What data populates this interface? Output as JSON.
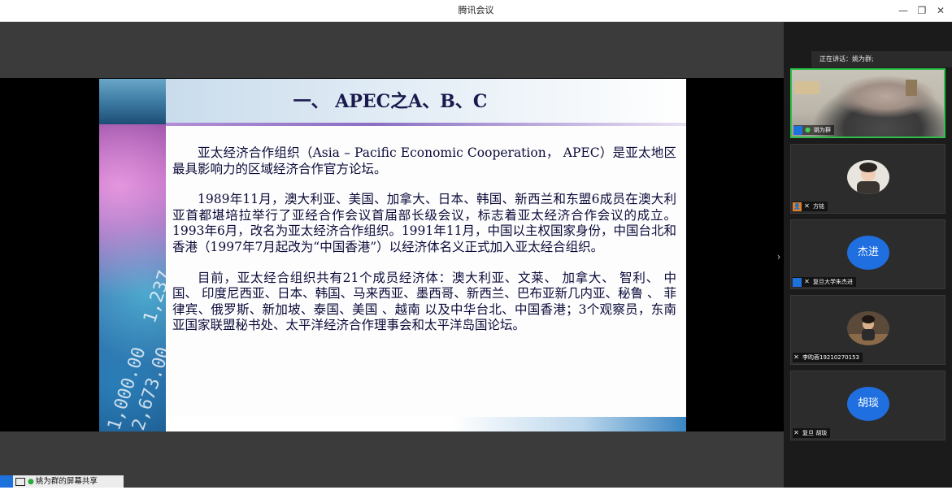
{
  "window": {
    "title": "腾讯会议",
    "minimize_icon": "—",
    "restore_icon": "❐",
    "close_icon": "✕"
  },
  "slide": {
    "title": "一、  APEC之A、B、C",
    "paragraphs": [
      "亚太经济合作组织（Asia – Pacific Economic Cooperation， APEC）是亚太地区最具影响力的区域经济合作官方论坛。",
      "1989年11月，澳大利亚、美国、加拿大、日本、韩国、新西兰和东盟6成员在澳大利亚首都堪培拉举行了亚经合作会议首届部长级会议，标志着亚太经济合作会议的成立。1993年6月，改名为亚太经济合作组织。1991年11月，中国以主权国家身份，中国台北和香港（1997年7月起改为“中国香港”）以经济体名义正式加入亚太经合组织。",
      "目前，亚太经合组织共有21个成员经济体：澳大利亚、文莱、 加拿大、 智利、 中国、 印度尼西亚、日本、韩国、马来西亚、墨西哥、新西兰、巴布亚新几内亚、秘鲁 、 菲律宾、俄罗斯、新加坡、泰国、美国 、越南 以及中华台北、中国香港；3个观察员，东南亚国家联盟秘书处、太平洋经济合作理事会和太平洋岛国论坛。"
    ],
    "deco_numbers": [
      "1,000.00",
      "2,673.00",
      "1,237"
    ]
  },
  "side_panel": {
    "speaking_label": "正在讲话：姚为群;",
    "participants": [
      {
        "name": "姚为群",
        "type": "video",
        "mic": "on"
      },
      {
        "name": "方铭",
        "type": "photo",
        "mic": "muted"
      },
      {
        "name": "复旦大学朱杰进",
        "type": "initials",
        "initials": "杰进",
        "mic": "muted"
      },
      {
        "name": "李昀蓉19210270153",
        "type": "photo",
        "mic": "muted"
      },
      {
        "name": "复旦 胡琰",
        "type": "initials",
        "initials": "胡琰",
        "mic": "muted"
      }
    ],
    "collapse_icon": "›"
  },
  "status_bar": {
    "share_label": "姚为群的屏幕共享"
  },
  "colors": {
    "accent_blue": "#1f6fe0",
    "speaking_green": "#2fbf4a",
    "slide_title": "#1a1a4e"
  }
}
